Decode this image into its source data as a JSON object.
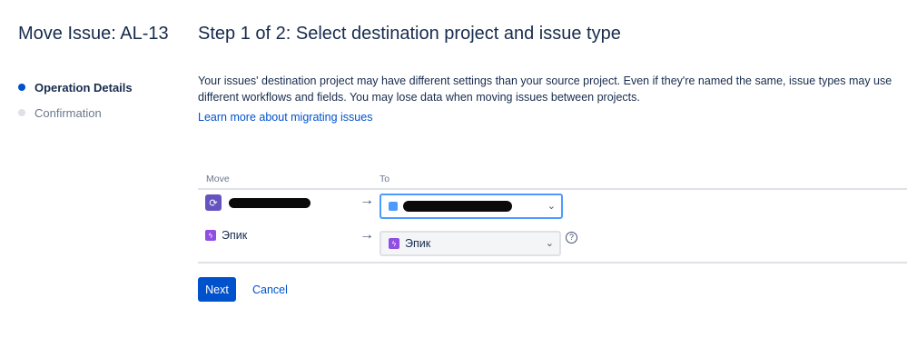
{
  "sidebar": {
    "title": "Move Issue: AL-13",
    "steps": [
      {
        "label": "Operation Details",
        "state": "active"
      },
      {
        "label": "Confirmation",
        "state": "inactive"
      }
    ]
  },
  "main": {
    "step_title": "Step 1 of 2: Select destination project and issue type",
    "description": "Your issues' destination project may have different settings than your source project. Even if they're named the same, issue types may use different workflows and fields. You may lose data when moving issues between projects.",
    "learn_more": "Learn more about migrating issues"
  },
  "table": {
    "headers": {
      "move": "Move",
      "to": "To"
    },
    "arrow": "→",
    "rows": [
      {
        "source_label": "",
        "destination": "",
        "icon": "project-icon"
      },
      {
        "source_label": "Эпик",
        "destination": "Эпик",
        "icon": "epic-icon"
      }
    ]
  },
  "buttons": {
    "next": "Next",
    "cancel": "Cancel"
  },
  "icons": {
    "chevron": "⌄",
    "help": "?"
  },
  "colors": {
    "primary": "#0052cc",
    "focus": "#4c9aff",
    "epic": "#904ee2",
    "project": "#6554c0"
  }
}
